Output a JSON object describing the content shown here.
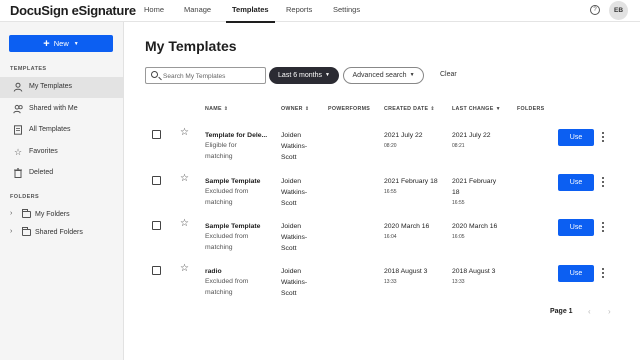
{
  "header": {
    "logo": "DocuSign eSignature",
    "nav": [
      {
        "label": "Home"
      },
      {
        "label": "Manage"
      },
      {
        "label": "Templates"
      },
      {
        "label": "Reports"
      },
      {
        "label": "Settings"
      }
    ],
    "active_nav": "Templates",
    "help_icon": "?",
    "avatar_initials": "EB"
  },
  "sidebar": {
    "new_button": "New",
    "templates_heading": "TEMPLATES",
    "items": [
      {
        "label": "My Templates",
        "icon": "user-icon"
      },
      {
        "label": "Shared with Me",
        "icon": "users-icon"
      },
      {
        "label": "All Templates",
        "icon": "document-icon"
      },
      {
        "label": "Favorites",
        "icon": "star-icon"
      },
      {
        "label": "Deleted",
        "icon": "trash-icon"
      }
    ],
    "selected_item": "My Templates",
    "folders_heading": "FOLDERS",
    "folders": [
      {
        "label": "My Folders"
      },
      {
        "label": "Shared Folders"
      }
    ]
  },
  "main": {
    "title": "My Templates",
    "search_placeholder": "Search My Templates",
    "date_filter": "Last 6 months",
    "advanced_search": "Advanced search",
    "clear": "Clear",
    "columns": {
      "name": "NAME",
      "owner": "OWNER",
      "powerforms": "POWERFORMS",
      "created": "CREATED DATE",
      "last_change": "LAST CHANGE",
      "folders": "FOLDERS"
    },
    "rows": [
      {
        "name": "Template for Dele...",
        "status_line1": "Eligible for",
        "status_line2": "matching",
        "owner_line1": "Joiden",
        "owner_line2": "Watkins-",
        "owner_line3": "Scott",
        "created_date": "2021 July 22",
        "created_time": "08:20",
        "changed_date": "2021 July 22",
        "changed_date2": "",
        "changed_time": "08:21",
        "action": "Use"
      },
      {
        "name": "Sample Template",
        "status_line1": "Excluded from",
        "status_line2": "matching",
        "owner_line1": "Joiden",
        "owner_line2": "Watkins-",
        "owner_line3": "Scott",
        "created_date": "2021 February 18",
        "created_time": "16:55",
        "changed_date": "2021 February",
        "changed_date2": "18",
        "changed_time": "16:55",
        "action": "Use"
      },
      {
        "name": "Sample Template",
        "status_line1": "Excluded from",
        "status_line2": "matching",
        "owner_line1": "Joiden",
        "owner_line2": "Watkins-",
        "owner_line3": "Scott",
        "created_date": "2020 March 16",
        "created_time": "16:04",
        "changed_date": "2020 March 16",
        "changed_date2": "",
        "changed_time": "16:05",
        "action": "Use"
      },
      {
        "name": "radio",
        "status_line1": "Excluded from",
        "status_line2": "matching",
        "owner_line1": "Joiden",
        "owner_line2": "Watkins-",
        "owner_line3": "Scott",
        "created_date": "2018 August 3",
        "created_time": "13:33",
        "changed_date": "2018 August 3",
        "changed_date2": "",
        "changed_time": "13:33",
        "action": "Use"
      }
    ],
    "pagination": "Page 1"
  },
  "colors": {
    "accent": "#0c5ff2",
    "dark_pill": "#2b2b33",
    "sidebar_bg": "#f5f5f5"
  }
}
